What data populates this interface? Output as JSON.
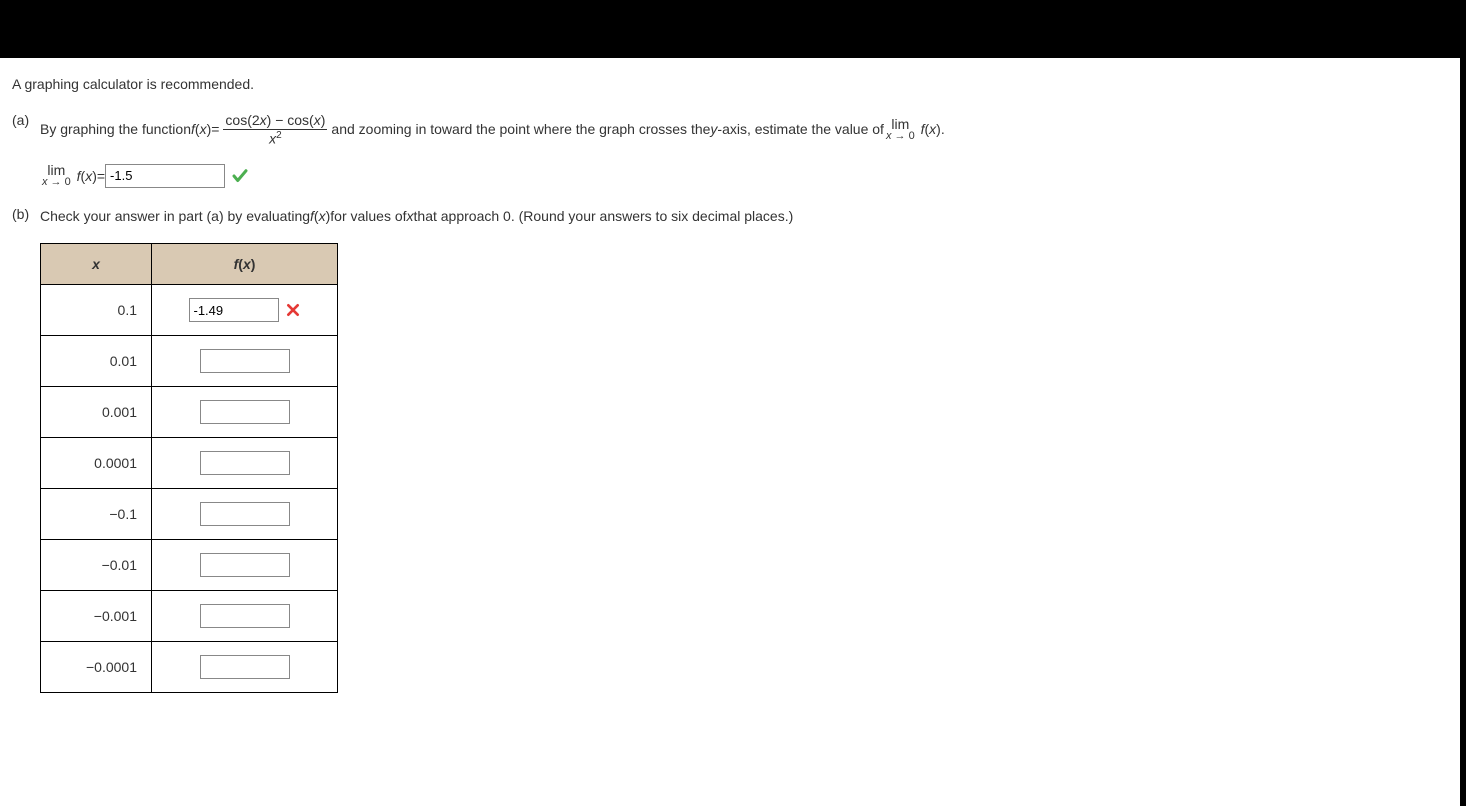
{
  "intro_text": "A graphing calculator is recommended.",
  "part_a": {
    "label": "(a)",
    "text_before_fn": "By graphing the function ",
    "fn_lhs_f": "f",
    "fn_lhs_x": "x",
    "equals": " = ",
    "frac_num_cos2x": "cos(2",
    "frac_num_x1": "x",
    "frac_num_mid": ") − cos(",
    "frac_num_x2": "x",
    "frac_num_end": ")",
    "frac_den_x": "x",
    "frac_den_exp": "2",
    "text_after_frac": " and zooming in toward the point where the graph crosses the ",
    "y_axis_y": "y",
    "y_axis_rest": "-axis, estimate the value of ",
    "lim_word": "lim",
    "lim_sub_x": "x",
    "lim_sub_arrow": " → 0",
    "lim_fn_f": "f",
    "lim_fn_x": "x",
    "period": ".",
    "answer_lim_word": "lim",
    "answer_lim_sub_x": "x",
    "answer_lim_sub_arrow": " → 0",
    "answer_fn_f": "f",
    "answer_fn_x": "x",
    "answer_equals": " = ",
    "answer_value": "-1.5"
  },
  "part_b": {
    "label": "(b)",
    "text_before": "Check your answer in part (a) by evaluating ",
    "fn_f": "f",
    "fn_x": "x",
    "text_mid": " for values of ",
    "var_x": "x",
    "text_after": " that approach 0. (Round your answers to six decimal places.)"
  },
  "table": {
    "header_x": "x",
    "header_fx_f": "f",
    "header_fx_x": "x",
    "rows": [
      {
        "x": "0.1",
        "value": "-1.49",
        "status": "wrong"
      },
      {
        "x": "0.01",
        "value": "",
        "status": "none"
      },
      {
        "x": "0.001",
        "value": "",
        "status": "none"
      },
      {
        "x": "0.0001",
        "value": "",
        "status": "none"
      },
      {
        "x": "−0.1",
        "value": "",
        "status": "none"
      },
      {
        "x": "−0.01",
        "value": "",
        "status": "none"
      },
      {
        "x": "−0.001",
        "value": "",
        "status": "none"
      },
      {
        "x": "−0.0001",
        "value": "",
        "status": "none"
      }
    ]
  }
}
